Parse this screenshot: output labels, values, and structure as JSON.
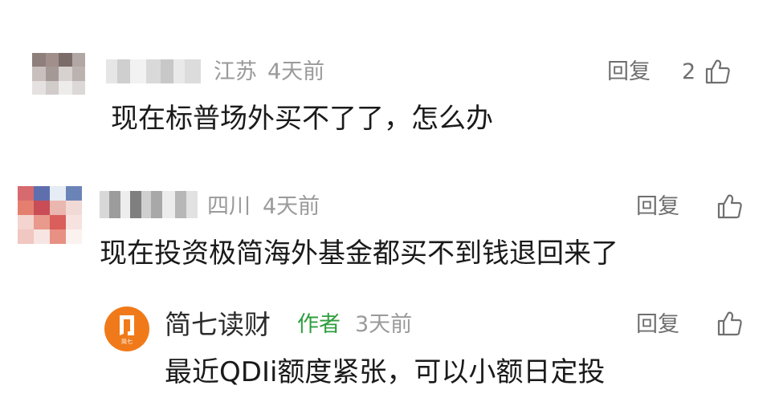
{
  "comments": [
    {
      "region": "江苏",
      "time": "4天前",
      "reply_label": "回复",
      "likes": "2",
      "text": "现在标普场外买不了了，怎么办"
    },
    {
      "region": "四川",
      "time": "4天前",
      "reply_label": "回复",
      "likes": "",
      "text": "现在投资极简海外基金都买不到钱退回来了",
      "reply": {
        "author": "简七读财",
        "badge": "作者",
        "time": "3天前",
        "reply_label": "回复",
        "text": "最近QDIi额度紧张，可以小额日定投",
        "logo_text": "简七"
      }
    }
  ],
  "colors": {
    "author_badge": "#2f9e3f",
    "logo_bg": "#f07a1a",
    "meta_text": "#9a9a9a"
  },
  "icons": {
    "like": "thumbs-up-icon"
  }
}
